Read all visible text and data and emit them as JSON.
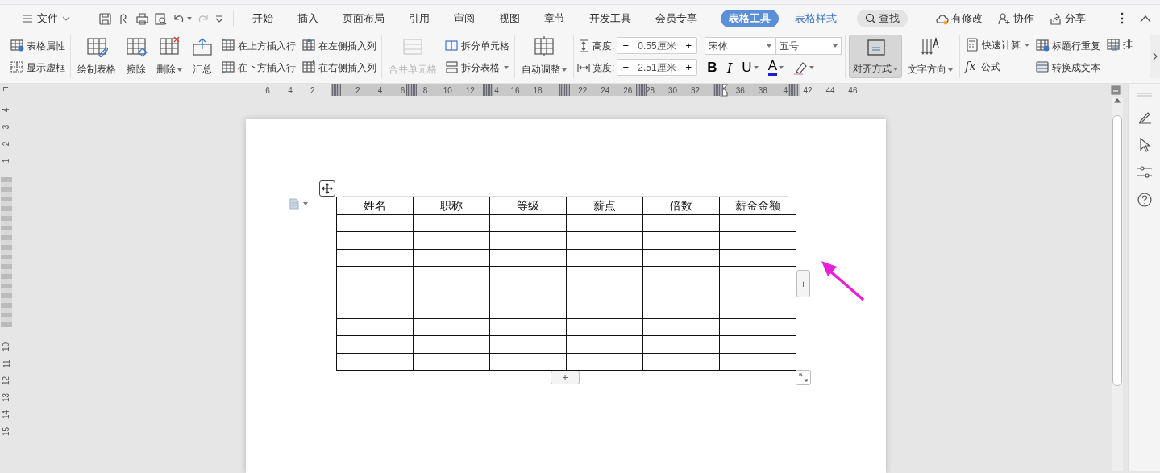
{
  "menu": {
    "file": "文件",
    "tabs": [
      {
        "label": "开始",
        "selected": false
      },
      {
        "label": "插入",
        "selected": false
      },
      {
        "label": "页面布局",
        "selected": false
      },
      {
        "label": "引用",
        "selected": false
      },
      {
        "label": "审阅",
        "selected": false
      },
      {
        "label": "视图",
        "selected": false
      },
      {
        "label": "章节",
        "selected": false
      },
      {
        "label": "开发工具",
        "selected": false
      },
      {
        "label": "会员专享",
        "selected": false
      },
      {
        "label": "表格工具",
        "selected": true
      },
      {
        "label": "表格样式",
        "selected": false
      }
    ],
    "search": "查找",
    "actions": [
      "有修改",
      "协作",
      "分享"
    ],
    "more": "⋮"
  },
  "ribbon": [
    [
      {
        "kind": "stack",
        "items": [
          {
            "label": "表格属性",
            "dropdown": false,
            "disabled": false
          },
          {
            "label": "显示虚框",
            "dropdown": false,
            "disabled": false
          }
        ]
      }
    ],
    [
      {
        "kind": "large",
        "label": "绘制表格",
        "dropdown": false,
        "disabled": false,
        "selected": false
      },
      {
        "kind": "large",
        "label": "擦除",
        "dropdown": false,
        "disabled": false,
        "selected": false
      },
      {
        "kind": "large",
        "label": "删除",
        "dropdown": true,
        "disabled": false,
        "selected": false
      },
      {
        "kind": "large",
        "label": "汇总",
        "dropdown": false,
        "disabled": false,
        "selected": false
      },
      {
        "kind": "stack",
        "items": [
          {
            "label": "在上方插入行",
            "dropdown": false,
            "disabled": false
          },
          {
            "label": "在下方插入行",
            "dropdown": false,
            "disabled": false
          }
        ]
      },
      {
        "kind": "stack",
        "items": [
          {
            "label": "在左侧插入列",
            "dropdown": false,
            "disabled": false
          },
          {
            "label": "在右侧插入列",
            "dropdown": false,
            "disabled": false
          }
        ]
      }
    ],
    [
      {
        "kind": "large",
        "label": "合并单元格",
        "dropdown": false,
        "disabled": true,
        "selected": false
      },
      {
        "kind": "stack",
        "items": [
          {
            "label": "拆分单元格",
            "dropdown": false,
            "disabled": false
          },
          {
            "label": "拆分表格",
            "dropdown": true,
            "disabled": false
          }
        ]
      }
    ],
    [
      {
        "kind": "large",
        "label": "自动调整",
        "dropdown": true,
        "disabled": false,
        "selected": false
      }
    ],
    [
      {
        "kind": "spins",
        "items": [
          {
            "label": "高度:",
            "minus": "−",
            "value": "0.55厘米",
            "plus": "+"
          },
          {
            "label": "宽度:",
            "minus": "−",
            "value": "2.51厘米",
            "plus": "+"
          }
        ]
      }
    ],
    [
      {
        "kind": "font",
        "font": "宋体",
        "size": "五号",
        "buttons": [
          {
            "kind": "glyph",
            "glyph": "B",
            "dropdown": false
          },
          {
            "kind": "glyph",
            "glyph": "I",
            "dropdown": false
          },
          {
            "kind": "glyph",
            "glyph": "U",
            "dropdown": true
          },
          {
            "kind": "glyph",
            "glyph": "A",
            "dropdown": true
          },
          {
            "kind": "highlight",
            "dropdown": true
          }
        ]
      }
    ],
    [
      {
        "kind": "large",
        "label": "对齐方式",
        "dropdown": true,
        "disabled": false,
        "selected": true
      },
      {
        "kind": "large",
        "label": "文字方向",
        "dropdown": true,
        "disabled": false,
        "selected": false
      }
    ],
    [
      {
        "kind": "stack",
        "items": [
          {
            "label": "快速计算",
            "dropdown": true,
            "disabled": false
          },
          {
            "label": "公式",
            "glyph": "fx",
            "dropdown": false,
            "disabled": false
          }
        ]
      },
      {
        "kind": "stack",
        "items": [
          {
            "label": "标题行重复",
            "dropdown": false,
            "disabled": false
          },
          {
            "label": "转换成文本",
            "dropdown": false,
            "disabled": false
          }
        ]
      },
      {
        "kind": "stack",
        "items": [
          {
            "label": "排",
            "dropdown": false,
            "disabled": false
          }
        ]
      }
    ]
  ],
  "ruler": [
    {
      "kind": "number",
      "label": "6"
    },
    {
      "kind": "number",
      "label": "4"
    },
    {
      "kind": "number",
      "label": "2"
    },
    {
      "kind": "hidden"
    },
    {
      "kind": "number",
      "label": "2"
    },
    {
      "kind": "number",
      "label": "4"
    },
    {
      "kind": "number",
      "label": "6"
    },
    {
      "kind": "number",
      "label": "8"
    },
    {
      "kind": "number",
      "label": "10"
    },
    {
      "kind": "number",
      "label": "12"
    },
    {
      "kind": "number",
      "label": "4"
    },
    {
      "kind": "number",
      "label": "16"
    },
    {
      "kind": "number",
      "label": "18"
    },
    {
      "kind": "hidden"
    },
    {
      "kind": "number",
      "label": "22"
    },
    {
      "kind": "number",
      "label": "24"
    },
    {
      "kind": "number",
      "label": "26"
    },
    {
      "kind": "number",
      "label": "28"
    },
    {
      "kind": "number",
      "label": "30"
    },
    {
      "kind": "number",
      "label": "32"
    },
    {
      "kind": "hidden"
    },
    {
      "kind": "number",
      "label": "36"
    },
    {
      "kind": "number",
      "label": "38"
    },
    {
      "kind": "number",
      "label": "4"
    },
    {
      "kind": "number",
      "label": "42"
    },
    {
      "kind": "number",
      "label": "44"
    },
    {
      "kind": "number",
      "label": "46"
    }
  ],
  "vertical_ruler": {
    "above": [
      "4",
      "3",
      "2",
      "1"
    ],
    "below": [
      "10",
      "11",
      "12",
      "13",
      "14",
      "15"
    ]
  },
  "table": {
    "columns": [
      "姓名",
      "职称",
      "等级",
      "薪点",
      "倍数",
      "薪金金额"
    ],
    "add_column": "+",
    "add_row": "+"
  }
}
